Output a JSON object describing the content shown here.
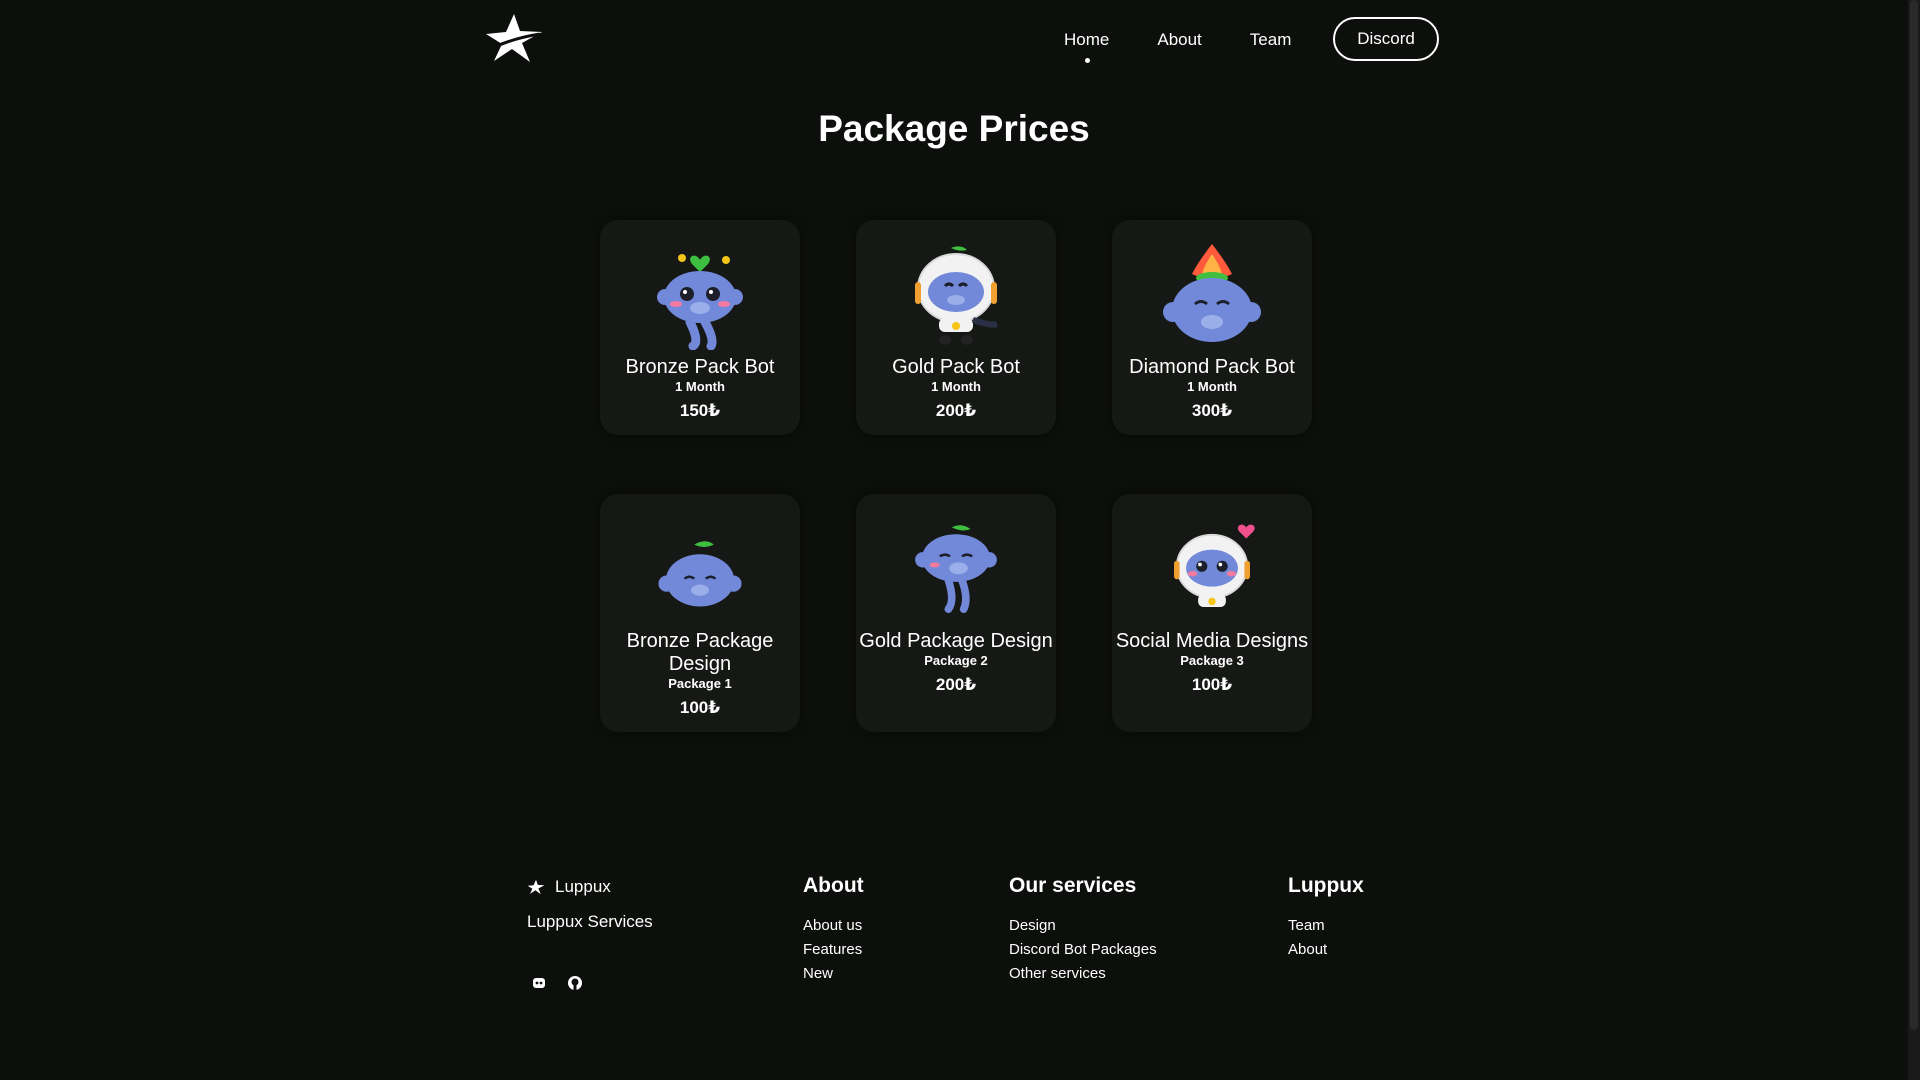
{
  "nav": {
    "links": [
      "Home",
      "About",
      "Team"
    ],
    "active": "Home",
    "discord_label": "Discord"
  },
  "page_title": "Package Prices",
  "cards": [
    {
      "name": "Bronze Pack Bot",
      "sub": "1 Month",
      "price": "150₺",
      "icon": "clyde-mascot-heart-icon"
    },
    {
      "name": "Gold Pack Bot",
      "sub": "1 Month",
      "price": "200₺",
      "icon": "clyde-mascot-astronaut-icon"
    },
    {
      "name": "Diamond Pack Bot",
      "sub": "1 Month",
      "price": "300₺",
      "icon": "clyde-mascot-fire-icon"
    },
    {
      "name": "Bronze Package Design",
      "sub": "Package 1",
      "price": "100₺",
      "icon": "clyde-mascot-leaf-icon"
    },
    {
      "name": "Gold Package Design",
      "sub": "Package 2",
      "price": "200₺",
      "icon": "clyde-mascot-wink-icon"
    },
    {
      "name": "Social Media Designs",
      "sub": "Package 3",
      "price": "100₺",
      "icon": "clyde-mascot-astronaut-heart-icon"
    }
  ],
  "footer": {
    "brand": "Luppux",
    "subtitle": "Luppux Services",
    "columns": [
      {
        "title": "About",
        "links": [
          "About us",
          "Features",
          "New"
        ]
      },
      {
        "title": "Our services",
        "links": [
          "Design",
          "Discord Bot Packages",
          "Other services"
        ]
      },
      {
        "title": "Luppux",
        "links": [
          "Team",
          "About"
        ]
      }
    ],
    "social_icons": [
      "discord-icon",
      "github-icon"
    ]
  },
  "colors": {
    "background": "#0d0f0c",
    "card": "#161815",
    "mascot_blue": "#7289da",
    "text": "#ffffff"
  }
}
